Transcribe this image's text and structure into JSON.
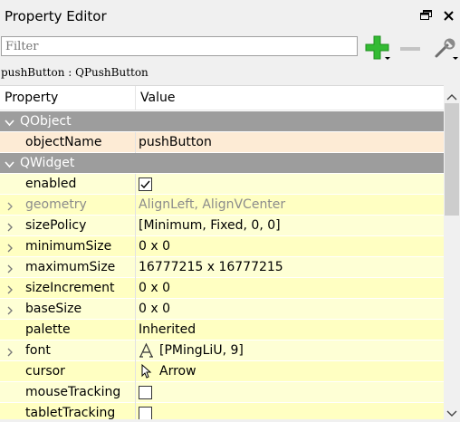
{
  "title": "Property Editor",
  "filter": {
    "placeholder": "Filter"
  },
  "object_label": "pushButton : QPushButton",
  "headers": {
    "property": "Property",
    "value": "Value"
  },
  "groups": {
    "qobject": "QObject",
    "qwidget": "QWidget"
  },
  "rows": {
    "objectName": {
      "name": "objectName",
      "value": "pushButton"
    },
    "enabled": {
      "name": "enabled",
      "checked": true
    },
    "geometry": {
      "name": "geometry",
      "value": "AlignLeft, AlignVCenter"
    },
    "sizePolicy": {
      "name": "sizePolicy",
      "value": "[Minimum, Fixed, 0, 0]"
    },
    "minimumSize": {
      "name": "minimumSize",
      "value": "0 x 0"
    },
    "maximumSize": {
      "name": "maximumSize",
      "value": "16777215 x 16777215"
    },
    "sizeIncrement": {
      "name": "sizeIncrement",
      "value": "0 x 0"
    },
    "baseSize": {
      "name": "baseSize",
      "value": "0 x 0"
    },
    "palette": {
      "name": "palette",
      "value": "Inherited"
    },
    "font": {
      "name": "font",
      "value": "[PMingLiU, 9]",
      "icon": "font-icon"
    },
    "cursor": {
      "name": "cursor",
      "value": "Arrow",
      "icon": "arrow-cursor-icon"
    },
    "mouseTracking": {
      "name": "mouseTracking",
      "checked": false
    },
    "tabletTracking": {
      "name": "tabletTracking",
      "checked": false
    }
  },
  "icons": {
    "add": "plus-icon",
    "remove": "minus-icon",
    "config": "wrench-icon",
    "float": "float-window-icon",
    "close": "close-icon"
  },
  "colors": {
    "group_bg": "#9d9d9d",
    "selected_row_bg": "#fdebd5",
    "row_bg": "#feffd5",
    "add_green": "#2eb82e"
  }
}
